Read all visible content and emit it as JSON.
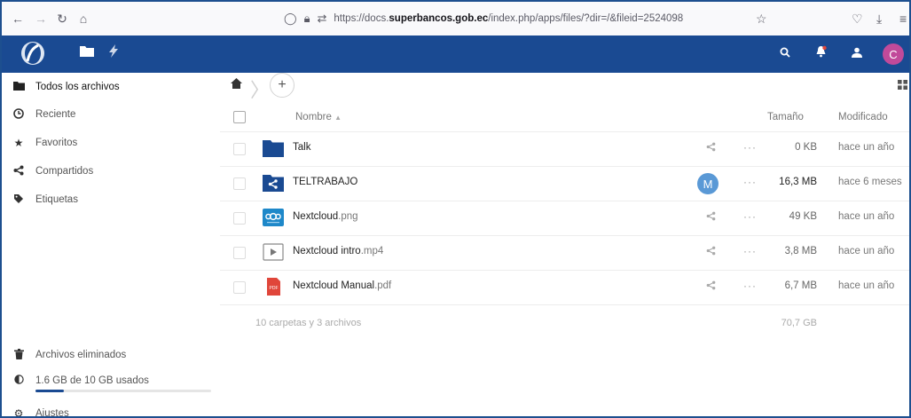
{
  "browser": {
    "url_prefix": "https://docs.",
    "url_domain": "superbancos.gob.ec",
    "url_suffix": "/index.php/apps/files/?dir=/&fileid=2524098"
  },
  "header": {
    "avatar_letter": "C",
    "icons": [
      "files-icon",
      "activity-icon",
      "search-icon",
      "notifications-icon",
      "contacts-icon"
    ]
  },
  "sidebar": {
    "items": [
      {
        "label": "Todos los archivos",
        "icon": "folder-icon"
      },
      {
        "label": "Reciente",
        "icon": "clock-icon"
      },
      {
        "label": "Favoritos",
        "icon": "star-icon"
      },
      {
        "label": "Compartidos",
        "icon": "share-icon"
      },
      {
        "label": "Etiquetas",
        "icon": "tag-icon"
      }
    ],
    "bottom": {
      "deleted": "Archivos eliminados",
      "quota": "1.6 GB de 10 GB usados",
      "quota_fraction": 0.16,
      "settings": "Ajustes"
    }
  },
  "table": {
    "headers": {
      "name": "Nombre",
      "size": "Tamaño",
      "modified": "Modificado"
    },
    "rows": [
      {
        "name": "Talk",
        "ext": "",
        "size": "0 KB",
        "modified": "hace un año",
        "type": "folder"
      },
      {
        "name": "TELTRABAJO",
        "ext": "",
        "size": "16,3 MB",
        "modified": "hace 6 meses",
        "type": "shared-folder",
        "shared_by": "M"
      },
      {
        "name": "Nextcloud",
        "ext": ".png",
        "size": "49 KB",
        "modified": "hace un año",
        "type": "image"
      },
      {
        "name": "Nextcloud intro",
        "ext": ".mp4",
        "size": "3,8 MB",
        "modified": "hace un año",
        "type": "video"
      },
      {
        "name": "Nextcloud Manual",
        "ext": ".pdf",
        "size": "6,7 MB",
        "modified": "hace un año",
        "type": "pdf"
      }
    ],
    "summary": "10 carpetas y 3 archivos",
    "total_size": "70,7 GB"
  },
  "colors": {
    "brand": "#1a4a92",
    "avatar": "#c14a9a",
    "share_avatar": "#5a99d6",
    "pdf": "#e0463a"
  }
}
